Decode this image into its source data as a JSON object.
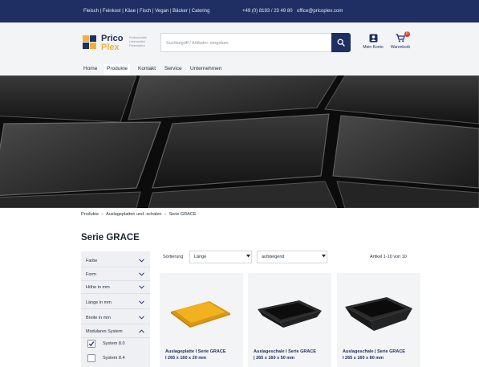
{
  "topbar": {
    "categories": "Fleisch | Feinkost | Käse | Fisch | Vegan | Bäcker | Catering",
    "phone": "+49 (0) 8193 / 23 49 80",
    "email": "office@pricoplex.com"
  },
  "header": {
    "logo_word_1": "Prico",
    "logo_word_2": "Plex",
    "logo_tagline": "Professionelle Lebensmittel Präsentation",
    "search_placeholder": "Suchbegriff / Artikelnr. eingeben",
    "account_label": "Mein Konto",
    "cart_label": "Warenkorb",
    "cart_count": "0"
  },
  "nav": {
    "items": [
      "Home",
      "Produkte",
      "Kontakt",
      "Service",
      "Unternehmen"
    ],
    "active": "Produkte"
  },
  "breadcrumb": [
    "Produkte",
    "Auslageplatten und -schalen",
    "Serie GRACE"
  ],
  "page_title": "Serie GRACE",
  "filters": {
    "groups": [
      "Farbe",
      "Form",
      "Höhe in mm",
      "Länge in mm",
      "Breite in mm",
      "Modulares System"
    ],
    "options": [
      {
        "label": "System 8.0",
        "checked": true
      },
      {
        "label": "System 8.4",
        "checked": false
      }
    ]
  },
  "sorting": {
    "label": "Sortierung",
    "field": "Länge",
    "direction": "aufsteigend",
    "count_text": "Artikel 1-10 von 10"
  },
  "products": [
    {
      "title_line1": "Auslageplatte I Serie GRACE",
      "title_line2": "I 265 x 160 x 20 mm",
      "color": "#f2b21f"
    },
    {
      "title_line1": "Auslageschale I Serie GRACE",
      "title_line2": "| 265 x 160 x 50 mm",
      "color": "#151515"
    },
    {
      "title_line1": "Auslageschale | Serie GRACE",
      "title_line2": "I 265 x 160 x 80 mm",
      "color": "#151515"
    }
  ],
  "colors": {
    "brand_navy": "#1f2e63",
    "brand_gold": "#f0b23a",
    "badge_red": "#e5362c"
  }
}
